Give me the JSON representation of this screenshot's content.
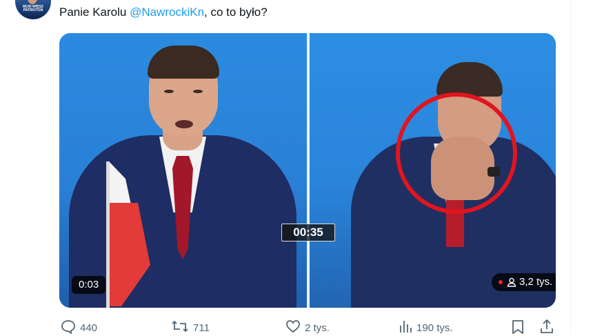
{
  "avatar": {
    "caption_line1": "MUSI WIĘSZ",
    "caption_line2": "PATRIOTON"
  },
  "tweet": {
    "text_prefix": "Panie Karolu ",
    "mention": "@NawrockiKn",
    "text_suffix": ", co to było?"
  },
  "video": {
    "center_timer": "00:35",
    "elapsed": "0:03",
    "views": "3,2 tys."
  },
  "actions": {
    "replies": "440",
    "reposts": "711",
    "likes": "2 tys.",
    "views": "190 tys."
  },
  "icons": {
    "reply": "reply-icon",
    "repost": "repost-icon",
    "like": "heart-icon",
    "views": "bar-chart-icon",
    "bookmark": "bookmark-icon",
    "share": "share-icon"
  },
  "colors": {
    "mention": "#1d9bf0",
    "secondary_text": "#536471",
    "highlight_circle": "#e0151f"
  }
}
